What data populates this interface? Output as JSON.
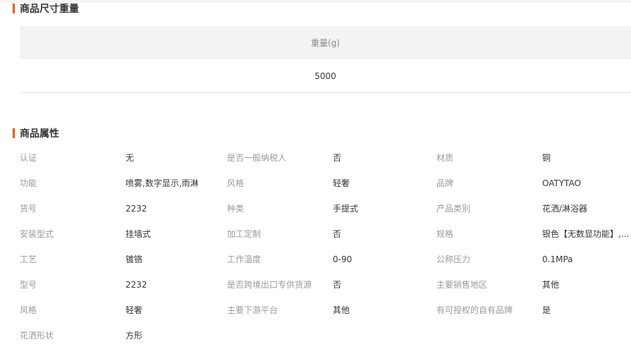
{
  "size_section": {
    "title": "商品尺寸重量",
    "table_header": "重量(g)",
    "table_value": "5000"
  },
  "attributes_section": {
    "title": "商品属性",
    "rows": [
      [
        {
          "label": "认证",
          "value": "无"
        },
        {
          "label": "是否一般纳税人",
          "value": "否"
        },
        {
          "label": "材质",
          "value": "铜"
        }
      ],
      [
        {
          "label": "功能",
          "value": "喷雾,数字显示,雨淋"
        },
        {
          "label": "风格",
          "value": "轻奢"
        },
        {
          "label": "品牌",
          "value": "OATYTAO"
        }
      ],
      [
        {
          "label": "货号",
          "value": "2232"
        },
        {
          "label": "种类",
          "value": "手提式"
        },
        {
          "label": "产品类别",
          "value": "花洒/淋浴器"
        }
      ],
      [
        {
          "label": "安装型式",
          "value": "挂墙式"
        },
        {
          "label": "加工定制",
          "value": "否"
        },
        {
          "label": "规格",
          "value": "银色【无数显功能】,..."
        }
      ],
      [
        {
          "label": "工艺",
          "value": "镀铬"
        },
        {
          "label": "工作温度",
          "value": "0-90"
        },
        {
          "label": "公称压力",
          "value": "0.1MPa"
        }
      ],
      [
        {
          "label": "型号",
          "value": "2232"
        },
        {
          "label": "是否跨境出口专供货源",
          "value": "否"
        },
        {
          "label": "主要销售地区",
          "value": "其他"
        }
      ],
      [
        {
          "label": "风格",
          "value": "轻奢"
        },
        {
          "label": "主要下游平台",
          "value": "其他"
        },
        {
          "label": "有可授权的自有品牌",
          "value": "是"
        }
      ],
      [
        {
          "label": "花洒形状",
          "value": "方形"
        }
      ]
    ]
  },
  "colors": {
    "accent": "#ff5000",
    "header_bg": "#f3f3f3",
    "label": "#999999",
    "value": "#333333"
  }
}
